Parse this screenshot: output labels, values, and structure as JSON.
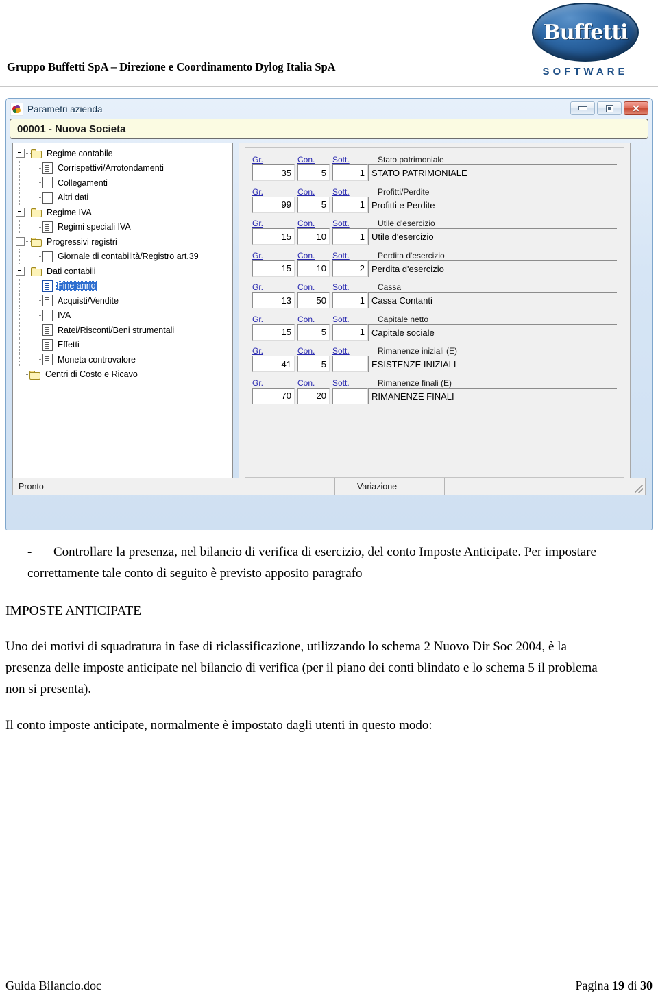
{
  "page_header": {
    "company_line": "Gruppo Buffetti SpA – Direzione e Coordinamento Dylog Italia SpA",
    "logo_word": "Buffetti",
    "logo_sub": "SOFTWARE"
  },
  "app_window": {
    "title": "Parametri azienda",
    "title_icon": "app-icon",
    "window_buttons": {
      "minimize": "minimize-icon",
      "maximize": "maximize-icon",
      "close": "✕"
    },
    "company_bar": "00001 - Nuova Societa",
    "tree": {
      "items": [
        {
          "label": "Regime contabile",
          "level": 0,
          "type": "folder",
          "expander": true,
          "selected": false
        },
        {
          "label": "Corrispettivi/Arrotondamenti",
          "level": 1,
          "type": "doc",
          "expander": false,
          "selected": false
        },
        {
          "label": "Collegamenti",
          "level": 1,
          "type": "doc",
          "expander": false,
          "selected": false
        },
        {
          "label": "Altri dati",
          "level": 1,
          "type": "doc",
          "expander": false,
          "selected": false
        },
        {
          "label": "Regime IVA",
          "level": 0,
          "type": "folder",
          "expander": true,
          "selected": false
        },
        {
          "label": "Regimi speciali IVA",
          "level": 1,
          "type": "doc",
          "expander": false,
          "selected": false
        },
        {
          "label": "Progressivi registri",
          "level": 0,
          "type": "folder",
          "expander": true,
          "selected": false
        },
        {
          "label": "Giornale di contabilità/Registro art.39",
          "level": 1,
          "type": "doc",
          "expander": false,
          "selected": false
        },
        {
          "label": "Dati contabili",
          "level": 0,
          "type": "folder",
          "expander": true,
          "selected": false
        },
        {
          "label": "Fine anno",
          "level": 1,
          "type": "doc",
          "expander": false,
          "selected": true
        },
        {
          "label": "Acquisti/Vendite",
          "level": 1,
          "type": "doc",
          "expander": false,
          "selected": false
        },
        {
          "label": "IVA",
          "level": 1,
          "type": "doc",
          "expander": false,
          "selected": false
        },
        {
          "label": "Ratei/Risconti/Beni strumentali",
          "level": 1,
          "type": "doc",
          "expander": false,
          "selected": false
        },
        {
          "label": "Effetti",
          "level": 1,
          "type": "doc",
          "expander": false,
          "selected": false
        },
        {
          "label": "Moneta controvalore",
          "level": 1,
          "type": "doc",
          "expander": false,
          "selected": false
        },
        {
          "label": "Centri di Costo e Ricavo",
          "level": 0,
          "type": "folder",
          "expander": false,
          "selected": false
        }
      ]
    },
    "form": {
      "col_labels": {
        "gr": "Gr.",
        "con": "Con.",
        "sott": "Sott."
      },
      "rows": [
        {
          "caption": "Stato patrimoniale",
          "gr": "35",
          "con": "5",
          "sott": "1",
          "desc": "STATO PATRIMONIALE"
        },
        {
          "caption": "Profitti/Perdite",
          "gr": "99",
          "con": "5",
          "sott": "1",
          "desc": "Profitti e Perdite"
        },
        {
          "caption": "Utile d'esercizio",
          "gr": "15",
          "con": "10",
          "sott": "1",
          "desc": "Utile d'esercizio"
        },
        {
          "caption": "Perdita d'esercizio",
          "gr": "15",
          "con": "10",
          "sott": "2",
          "desc": "Perdita d'esercizio"
        },
        {
          "caption": "Cassa",
          "gr": "13",
          "con": "50",
          "sott": "1",
          "desc": "Cassa Contanti"
        },
        {
          "caption": "Capitale netto",
          "gr": "15",
          "con": "5",
          "sott": "1",
          "desc": "Capitale sociale"
        },
        {
          "caption": "Rimanenze iniziali (E)",
          "gr": "41",
          "con": "5",
          "sott": "",
          "desc": "ESISTENZE INIZIALI"
        },
        {
          "caption": "Rimanenze finali (E)",
          "gr": "70",
          "con": "20",
          "sott": "",
          "desc": "RIMANENZE FINALI"
        }
      ]
    },
    "statusbar": {
      "state": "Pronto",
      "mode": "Variazione",
      "resize_grip": "resize-grip-icon"
    }
  },
  "document": {
    "bullet_dash": "-",
    "bullet_text": "Controllare la presenza, nel bilancio di verifica di esercizio, del conto Imposte Anticipate. Per impostare correttamente tale conto di seguito è previsto apposito paragrafo",
    "section_heading": "IMPOSTE ANTICIPATE",
    "paragraph_1": "Uno dei motivi di squadratura in fase di riclassificazione, utilizzando lo schema 2 Nuovo Dir Soc 2004, è la presenza delle imposte anticipate nel bilancio di verifica (per il piano dei conti blindato e lo schema 5 il problema non si presenta).",
    "paragraph_2": "Il conto imposte anticipate, normalmente è impostato dagli utenti in questo modo:"
  },
  "footer": {
    "doc_name": "Guida Bilancio.doc",
    "page_prefix": "Pagina ",
    "page_number": "19",
    "page_mid": " di ",
    "page_total": "30"
  },
  "colors": {
    "accent_blue": "#2a2ab0",
    "selection_blue": "#2f6fd0",
    "window_frame": "#7ea6cc",
    "company_bar_bg": "#fbfbe2",
    "brand_blue": "#1e4f86"
  }
}
